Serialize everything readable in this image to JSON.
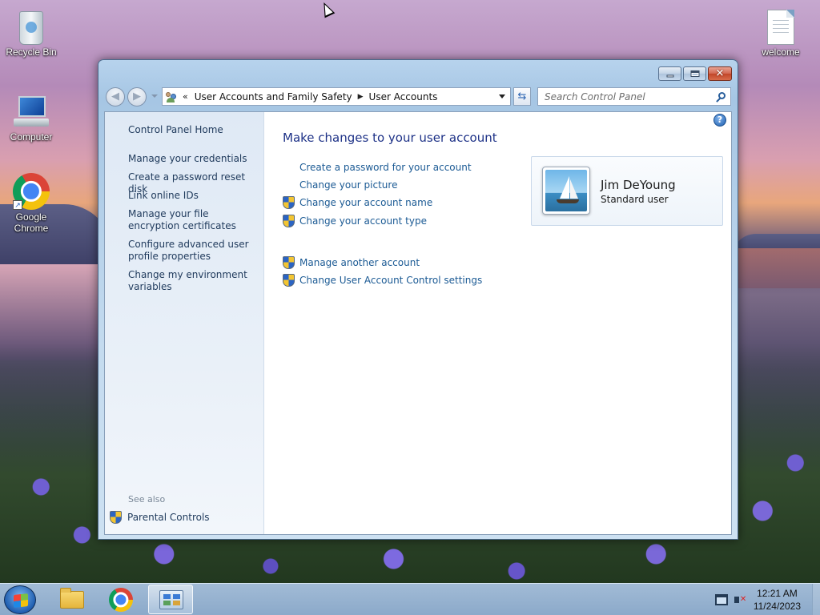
{
  "desktop": {
    "icons": {
      "recycle_bin": "Recycle Bin",
      "computer": "Computer",
      "chrome_line1": "Google",
      "chrome_line2": "Chrome",
      "welcome": "welcome"
    }
  },
  "window": {
    "address": {
      "overflow": "«",
      "crumb1": "User Accounts and Family Safety",
      "crumb2": "User Accounts"
    },
    "search_placeholder": "Search Control Panel",
    "sidebar": {
      "home": "Control Panel Home",
      "links": [
        "Manage your credentials",
        "Create a password reset disk",
        "Link online IDs",
        "Manage your file encryption certificates",
        "Configure advanced user profile properties",
        "Change my environment variables"
      ],
      "see_also": "See also",
      "parental": "Parental Controls"
    },
    "main": {
      "title": "Make changes to your user account",
      "tasks": [
        "Create a password for your account",
        "Change your picture",
        "Change your account name",
        "Change your account type"
      ],
      "other_tasks": [
        "Manage another account",
        "Change User Account Control settings"
      ]
    },
    "user": {
      "name": "Jim DeYoung",
      "type": "Standard user"
    }
  },
  "taskbar": {
    "time": "12:21 AM",
    "date": "11/24/2023"
  }
}
